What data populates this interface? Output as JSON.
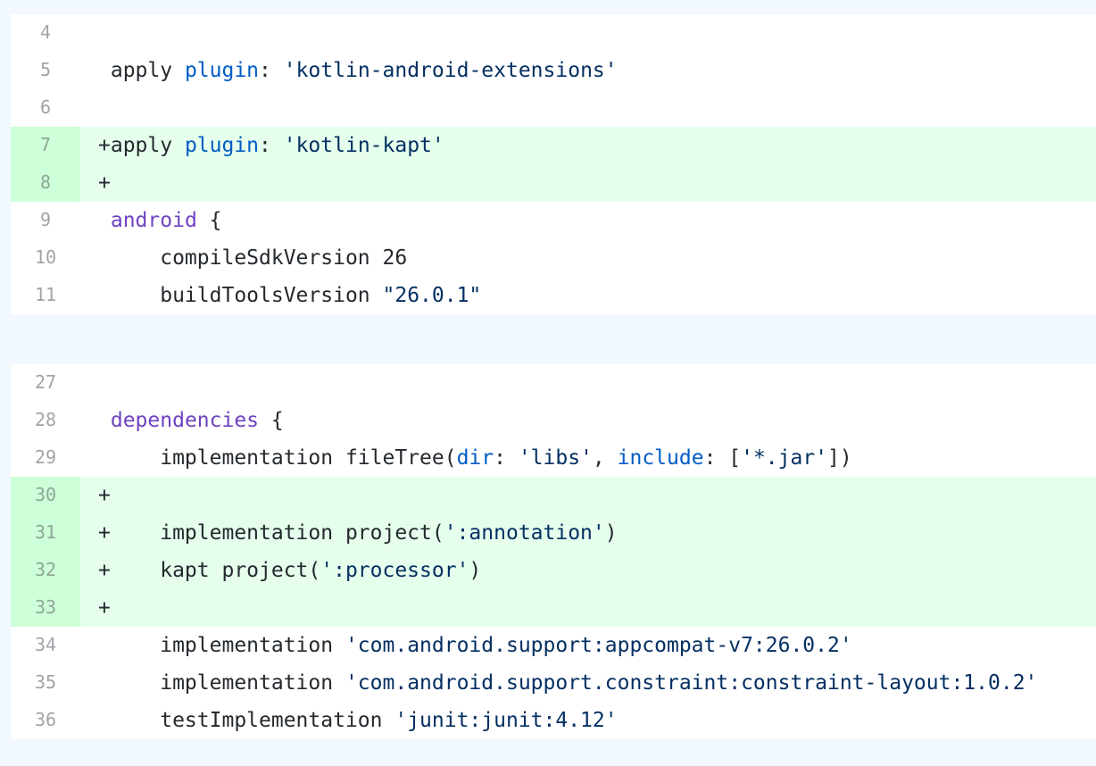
{
  "hunks": [
    {
      "lines": [
        {
          "num": "4",
          "type": "context",
          "tokens": []
        },
        {
          "num": "5",
          "type": "context",
          "tokens": [
            {
              "t": " apply ",
              "c": "op"
            },
            {
              "t": "plugin",
              "c": "prop"
            },
            {
              "t": ": ",
              "c": "op"
            },
            {
              "t": "'kotlin-android-extensions'",
              "c": "str"
            }
          ]
        },
        {
          "num": "6",
          "type": "context",
          "tokens": []
        },
        {
          "num": "7",
          "type": "add",
          "tokens": [
            {
              "t": "+apply ",
              "c": "op"
            },
            {
              "t": "plugin",
              "c": "prop"
            },
            {
              "t": ": ",
              "c": "op"
            },
            {
              "t": "'kotlin-kapt'",
              "c": "str"
            }
          ]
        },
        {
          "num": "8",
          "type": "add",
          "tokens": [
            {
              "t": "+",
              "c": "op"
            }
          ]
        },
        {
          "num": "9",
          "type": "context",
          "tokens": [
            {
              "t": " ",
              "c": "op"
            },
            {
              "t": "android",
              "c": "kw"
            },
            {
              "t": " {",
              "c": "op"
            }
          ]
        },
        {
          "num": "10",
          "type": "context",
          "tokens": [
            {
              "t": "     compileSdkVersion 26",
              "c": "op"
            }
          ]
        },
        {
          "num": "11",
          "type": "context",
          "tokens": [
            {
              "t": "     buildToolsVersion ",
              "c": "op"
            },
            {
              "t": "\"26.0.1\"",
              "c": "str"
            }
          ]
        }
      ]
    },
    {
      "lines": [
        {
          "num": "27",
          "type": "context",
          "tokens": []
        },
        {
          "num": "28",
          "type": "context",
          "tokens": [
            {
              "t": " ",
              "c": "op"
            },
            {
              "t": "dependencies",
              "c": "kw"
            },
            {
              "t": " {",
              "c": "op"
            }
          ]
        },
        {
          "num": "29",
          "type": "context",
          "tokens": [
            {
              "t": "     implementation fileTree(",
              "c": "op"
            },
            {
              "t": "dir",
              "c": "prop"
            },
            {
              "t": ": ",
              "c": "op"
            },
            {
              "t": "'libs'",
              "c": "str"
            },
            {
              "t": ", ",
              "c": "op"
            },
            {
              "t": "include",
              "c": "prop"
            },
            {
              "t": ": [",
              "c": "op"
            },
            {
              "t": "'*.jar'",
              "c": "str"
            },
            {
              "t": "])",
              "c": "op"
            }
          ]
        },
        {
          "num": "30",
          "type": "add",
          "tokens": [
            {
              "t": "+",
              "c": "op"
            }
          ]
        },
        {
          "num": "31",
          "type": "add",
          "tokens": [
            {
              "t": "+    implementation project(",
              "c": "op"
            },
            {
              "t": "':annotation'",
              "c": "str"
            },
            {
              "t": ")",
              "c": "op"
            }
          ]
        },
        {
          "num": "32",
          "type": "add",
          "tokens": [
            {
              "t": "+    kapt project(",
              "c": "op"
            },
            {
              "t": "':processor'",
              "c": "str"
            },
            {
              "t": ")",
              "c": "op"
            }
          ]
        },
        {
          "num": "33",
          "type": "add",
          "tokens": [
            {
              "t": "+",
              "c": "op"
            }
          ]
        },
        {
          "num": "34",
          "type": "context",
          "tokens": [
            {
              "t": "     implementation ",
              "c": "op"
            },
            {
              "t": "'com.android.support:appcompat-v7:26.0.2'",
              "c": "str"
            }
          ]
        },
        {
          "num": "35",
          "type": "context",
          "tokens": [
            {
              "t": "     implementation ",
              "c": "op"
            },
            {
              "t": "'com.android.support.constraint:constraint-layout:1.0.2'",
              "c": "str"
            }
          ]
        },
        {
          "num": "36",
          "type": "context",
          "tokens": [
            {
              "t": "     testImplementation ",
              "c": "op"
            },
            {
              "t": "'junit:junit:4.12'",
              "c": "str"
            }
          ]
        }
      ]
    }
  ],
  "colors": {
    "add_bg": "#e6ffed",
    "add_gutter": "#cdffd8",
    "hunk_separator": "#f1f8ff",
    "keyword": "#6f42c1",
    "property": "#005cc5",
    "string": "#032f62",
    "text": "#24292e"
  }
}
